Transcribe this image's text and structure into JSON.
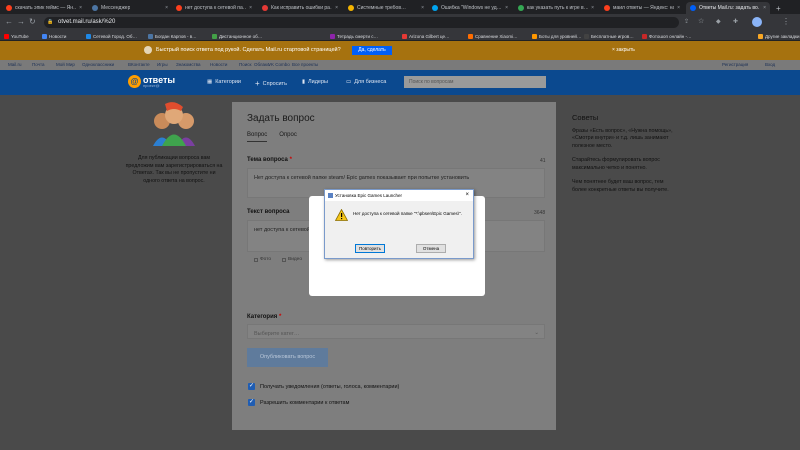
{
  "browser": {
    "tabs": [
      {
        "label": "скачать эпик геймс — Ян…",
        "color": "#fc3f1d"
      },
      {
        "label": "Мессенджер",
        "color": "#4c75a3"
      },
      {
        "label": "нет доступа к сетевой па…",
        "color": "#fc3f1d"
      },
      {
        "label": "Как исправить ошибки ра…",
        "color": "#e53935"
      },
      {
        "label": "Системные требов…",
        "color": "#f4b400"
      },
      {
        "label": "Ошибка \"Windows не уд…",
        "color": "#00a4ef"
      },
      {
        "label": "как указать путь к игре в…",
        "color": "#34a853"
      },
      {
        "label": "маил ответы — Яндекс: на…",
        "color": "#fc3f1d"
      },
      {
        "label": "Ответы Mail.ru: задать во…",
        "color": "#005ff9"
      }
    ],
    "new_tab": "+",
    "url": "otvet.mail.ru/ask/%20",
    "bookmarks": [
      {
        "label": "YouTube",
        "color": "#ff0000"
      },
      {
        "label": "Новости",
        "color": "#4285f4"
      },
      {
        "label": "Сетевой Город. Об…",
        "color": "#1e88e5"
      },
      {
        "label": "Богдан Карпов - в…",
        "color": "#4c75a3"
      },
      {
        "label": "Дистанционное об…",
        "color": "#43a047"
      },
      {
        "label": "Тетрадь смерти с…",
        "color": "#8e24aa"
      },
      {
        "label": "Arizona Gilbert це…",
        "color": "#e53935"
      },
      {
        "label": "Сравнение Xiaomi…",
        "color": "#ff6d00"
      },
      {
        "label": "Боты для уровней…",
        "color": "#ff9800"
      },
      {
        "label": "Бесплатные игров…",
        "color": "#424242"
      },
      {
        "label": "Фотошоп онлайн -…",
        "color": "#c62828"
      },
      {
        "label": "Другие закладки",
        "color": "#f9a825"
      }
    ]
  },
  "promo": {
    "text": "Быстрый поиск ответа под рукой. Сделать Mail.ru стартовой страницей?",
    "button": "Да, сделать",
    "close": "× закрыть"
  },
  "mail_nav": {
    "items": [
      "Mail.ru",
      "Почта",
      "Мой Мир",
      "Одноклассники",
      "ВКонтакте",
      "Игры",
      "Знакомства",
      "Новости",
      "Поиск",
      "Облако",
      "VK Combo",
      "Все проекты"
    ],
    "register": "Регистрация",
    "login": "Вход"
  },
  "header": {
    "logo": "ответы",
    "logo_sub": "проект@",
    "categories": "Категории",
    "ask": "Спросить",
    "leaders": "Лидеры",
    "business": "Для бизнеса",
    "search_placeholder": "Поиск по вопросам"
  },
  "sidebar": {
    "text": "Для публикации вопроса вам предложим вам зарегистрироваться на Ответах. Так вы не пропустите ни одного ответа на вопрос."
  },
  "form": {
    "title": "Задать вопрос",
    "tab_question": "Вопрос",
    "tab_poll": "Опрос",
    "topic_label": "Тема вопроса",
    "topic_counter": "41",
    "topic_value": "Нет доступа к сетевой папке steam/ Epic games показывает при попытке установить",
    "text_label": "Текст вопроса",
    "text_counter": "3648",
    "text_value": "нет доступа к сетевой папке … лить пишет когда я запускаю установщ…",
    "attach_photo": "Фото",
    "attach_video": "Видео",
    "category_label": "Категория",
    "category_placeholder": "Выберите катег…",
    "publish": "Опубликовать вопрос",
    "notify": "Получать уведомления (ответы, голоса, комментарии)",
    "allow_comments": "Разрешить комментарии к ответам"
  },
  "tips": {
    "title": "Советы",
    "items": [
      "Фразы «Есть вопрос», «Нужна помощь», «Смотри внутри» и т.д. лишь занимают полезное место.",
      "Старайтесь формулировать вопрос максимально четко и понятно.",
      "Чем понятнее будет ваш вопрос, тем более конкретные ответы вы получите."
    ]
  },
  "dialog": {
    "title": "Установка Epic Games Launcher",
    "message": "Нет доступа к сетевой папке \"*:\\pbsen\\Epic Games\\\".",
    "retry": "Повторить",
    "cancel": "Отмена"
  }
}
